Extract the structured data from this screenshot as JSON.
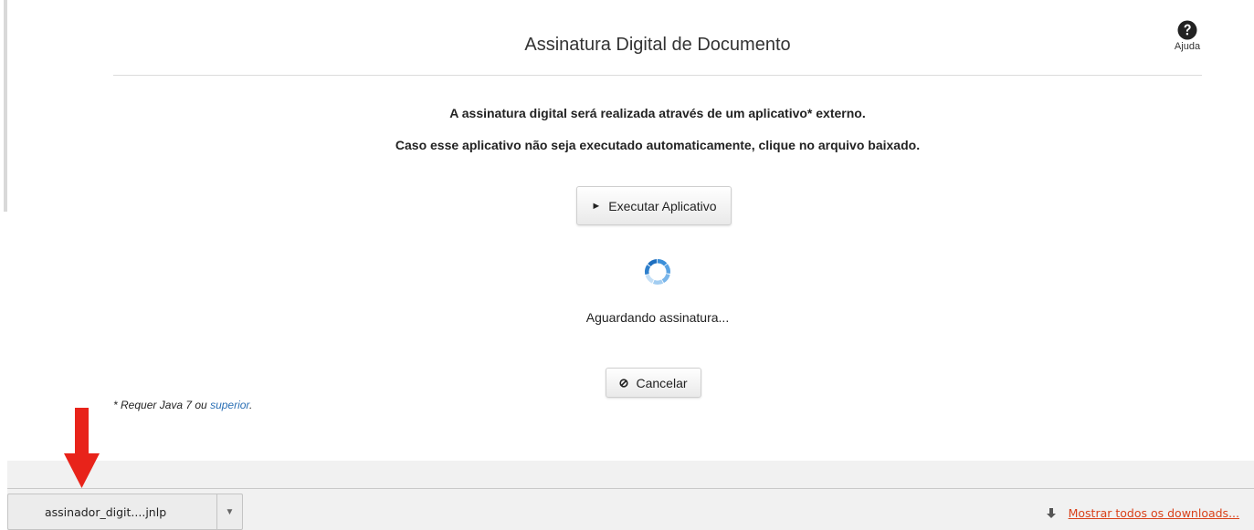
{
  "header": {
    "title": "Assinatura Digital de Documento",
    "help_label": "Ajuda"
  },
  "main": {
    "message_line1": "A assinatura digital será realizada através de um aplicativo* externo.",
    "message_line2": "Caso esse aplicativo não seja executado automaticamente, clique no arquivo baixado.",
    "run_button_label": "Executar Aplicativo",
    "status_text": "Aguardando assinatura...",
    "cancel_button_label": "Cancelar",
    "footnote_text": "* Requer Java 7 ou ",
    "footnote_link": "superior",
    "footnote_end": "."
  },
  "download_bar": {
    "file_name": "assinador_digit....jnlp",
    "show_all_label": "Mostrar todos os downloads..."
  },
  "icons": {
    "help": "question-circle-icon",
    "run": "play-triangle-icon",
    "cancel": "ban-icon",
    "spinner": "loading-spinner-icon",
    "dropdown": "chevron-down-icon",
    "download": "download-arrow-icon",
    "annotation": "red-arrow-icon"
  },
  "colors": {
    "link": "#2a6fb5",
    "download_link": "#d9421b",
    "spinner": "#3b8fd9",
    "annotation_arrow": "#e8231a"
  }
}
